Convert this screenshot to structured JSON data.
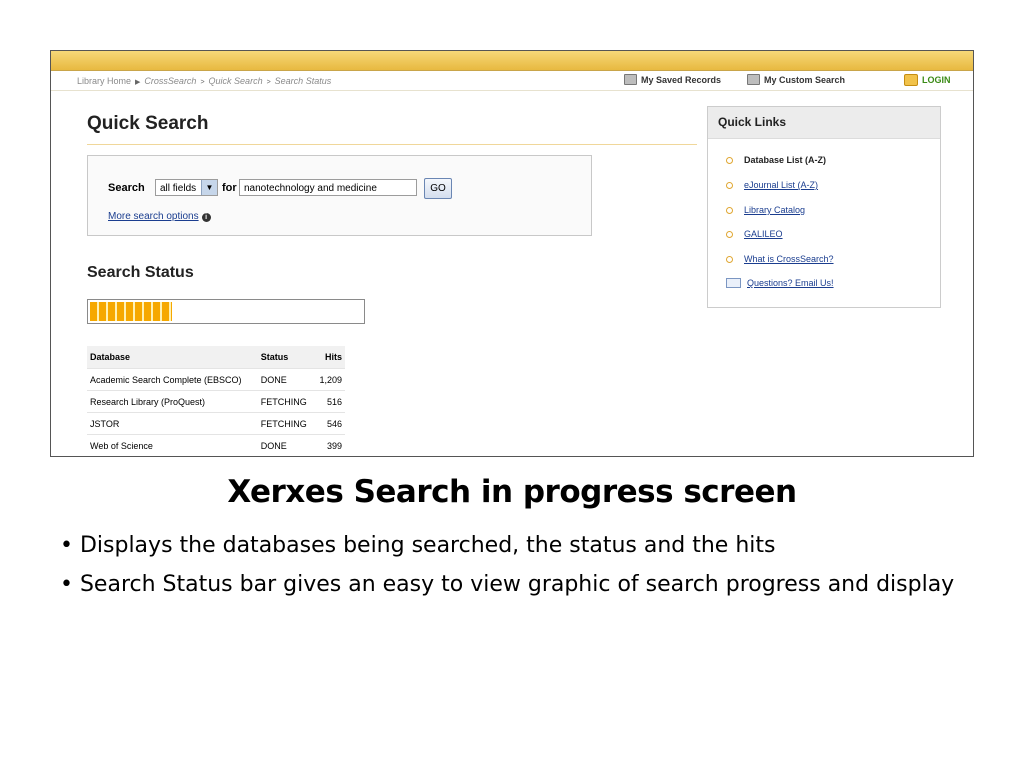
{
  "header": {
    "breadcrumb": [
      "Library Home",
      "CrossSearch",
      "Quick Search",
      "Search Status"
    ],
    "saved_records": "My Saved Records",
    "custom_search": "My Custom Search",
    "login": "LOGIN"
  },
  "quick_search": {
    "title": "Quick Search",
    "search_label": "Search",
    "field_select": "all fields",
    "for_label": "for",
    "query": "nanotechnology and medicine",
    "go_button": "GO",
    "more_options": "More search options"
  },
  "search_status": {
    "title": "Search Status",
    "progress_fraction": 0.3
  },
  "results": {
    "columns": [
      "Database",
      "Status",
      "Hits"
    ],
    "rows": [
      [
        "Academic Search Complete (EBSCO)",
        "DONE",
        "1,209"
      ],
      [
        "Research Library (ProQuest)",
        "FETCHING",
        "516"
      ],
      [
        "JSTOR",
        "FETCHING",
        "546"
      ],
      [
        "Web of Science",
        "DONE",
        "399"
      ]
    ]
  },
  "quick_links": {
    "title": "Quick Links",
    "items": [
      "Database List (A-Z)",
      "eJournal List (A-Z)",
      "Library Catalog",
      "GALILEO",
      "What is CrossSearch?",
      "Questions? Email Us!"
    ]
  },
  "slide": {
    "title": "Xerxes Search in progress screen",
    "bullets": [
      "• Displays the databases being searched, the status and the hits",
      "• Search Status bar gives an easy to view graphic of search progress and display"
    ]
  },
  "colors": {
    "header_gold": "#f6d878",
    "progress_orange": "#f6a800",
    "link_blue": "#1a3d8f",
    "login_green": "#3b8b17"
  }
}
